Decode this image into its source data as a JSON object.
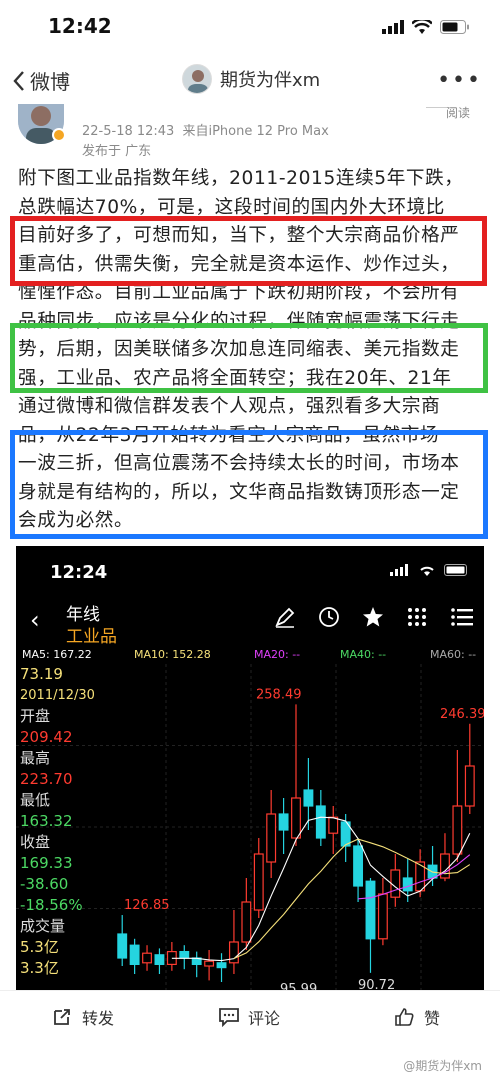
{
  "status": {
    "time": "12:42"
  },
  "nav": {
    "back_label": "微博",
    "user": "期货为伴xm"
  },
  "author": {
    "name": "期货为伴xm",
    "date": "22-5-18 12:43",
    "source": "来自iPhone 12 Pro Max",
    "location": "发布于 广东",
    "read_label": "阅读"
  },
  "post_lines": [
    "附下图工业品指数年线，2011-2015连续5年下跌，",
    "总跌幅达70%，可是，这段时间的国内外大环境比",
    "目前好多了，可想而知，当下，整个大宗商品价格严",
    "重高估，供需失衡，完全就是资本运作、炒作过头，",
    "惺惺作态。目前工业品属于下跌初期阶段，不会所有",
    "品种同步，应该是分化的过程，伴随宽幅震荡下行走",
    "势，后期，因美联储多次加息连同缩表、美元指数走",
    "强，工业品、农产品将全面转空；我在20年、21年",
    "通过微博和微信群发表个人观点，强烈看多大宗商",
    "品，从22年3月开始转为看空大宗商品，虽然市场",
    "一波三折，但高位震荡不会持续太长的时间，市场本",
    "身就是有结构的，所以，文华商品指数铸顶形态一定",
    "会成为必然。"
  ],
  "colors": {
    "up": "#ff3b30",
    "down": "#25d4e0",
    "ma5": "#ffffff",
    "ma10": "#f5e07a",
    "ma20": "#e040fb",
    "ma40": "#4cd964",
    "ma60": "#aaaaaa",
    "highlight_red": "#e32020",
    "highlight_green": "#3fc244",
    "highlight_blue": "#1b78ff"
  },
  "embedded": {
    "time": "12:24",
    "period": "年线",
    "name": "工业品",
    "ma": {
      "ma5": "MA5: 167.22",
      "ma10": "MA10: 152.28",
      "ma20": "MA20: --",
      "ma40": "MA40: --",
      "ma60": "MA60: --"
    },
    "side": {
      "price": "73.19",
      "date": "2011/12/30",
      "open_label": "开盘",
      "open": "209.42",
      "high_label": "最高",
      "high": "223.70",
      "low_label": "最低",
      "low": "163.32",
      "close_label": "收盘",
      "close": "169.33",
      "change": "-38.60",
      "pct": "-18.56%",
      "vol_label": "成交量",
      "vol": "5.3亿",
      "vol2": "3.3亿"
    }
  },
  "chart_data": {
    "type": "candlestick",
    "title": "工业品 年线",
    "annotations": [
      "258.49",
      "246.39",
      "126.85",
      "90.72",
      "95.99"
    ],
    "candles": [
      {
        "open": 115,
        "close": 100,
        "high": 126.85,
        "low": 95
      },
      {
        "open": 108,
        "close": 96,
        "high": 112,
        "low": 90
      },
      {
        "open": 97,
        "close": 103,
        "high": 108,
        "low": 92
      },
      {
        "open": 102,
        "close": 96,
        "high": 106,
        "low": 90
      },
      {
        "open": 96,
        "close": 104,
        "high": 110,
        "low": 92
      },
      {
        "open": 104,
        "close": 100,
        "high": 108,
        "low": 93
      },
      {
        "open": 100,
        "close": 96,
        "high": 104,
        "low": 88
      },
      {
        "open": 95,
        "close": 98,
        "high": 105,
        "low": 86
      },
      {
        "open": 97,
        "close": 94,
        "high": 103,
        "low": 85
      },
      {
        "open": 97,
        "close": 110,
        "high": 130,
        "low": 90
      },
      {
        "open": 110,
        "close": 135,
        "high": 150,
        "low": 105
      },
      {
        "open": 130,
        "close": 165,
        "high": 175,
        "low": 125
      },
      {
        "open": 160,
        "close": 190,
        "high": 205,
        "low": 150
      },
      {
        "open": 190,
        "close": 180,
        "high": 200,
        "low": 165
      },
      {
        "open": 175,
        "close": 200,
        "high": 258.49,
        "low": 170
      },
      {
        "open": 205,
        "close": 195,
        "high": 225,
        "low": 180
      },
      {
        "open": 195,
        "close": 175,
        "high": 205,
        "low": 170
      },
      {
        "open": 178,
        "close": 188,
        "high": 195,
        "low": 165
      },
      {
        "open": 185,
        "close": 170,
        "high": 190,
        "low": 160
      },
      {
        "open": 170,
        "close": 145,
        "high": 175,
        "low": 135
      },
      {
        "open": 148,
        "close": 112,
        "high": 150,
        "low": 90.72
      },
      {
        "open": 112,
        "close": 140,
        "high": 150,
        "low": 108
      },
      {
        "open": 138,
        "close": 155,
        "high": 165,
        "low": 132
      },
      {
        "open": 150,
        "close": 142,
        "high": 162,
        "low": 135
      },
      {
        "open": 142,
        "close": 160,
        "high": 168,
        "low": 138
      },
      {
        "open": 158,
        "close": 150,
        "high": 170,
        "low": 145
      },
      {
        "open": 150,
        "close": 165,
        "high": 178,
        "low": 148
      },
      {
        "open": 165,
        "close": 195,
        "high": 230,
        "low": 160
      },
      {
        "open": 195,
        "close": 220,
        "high": 246.39,
        "low": 190
      }
    ],
    "ylim": [
      85,
      270
    ]
  },
  "bottom": {
    "repost": "转发",
    "comment": "评论",
    "like": "赞",
    "watermark": "@期货为伴xm"
  }
}
